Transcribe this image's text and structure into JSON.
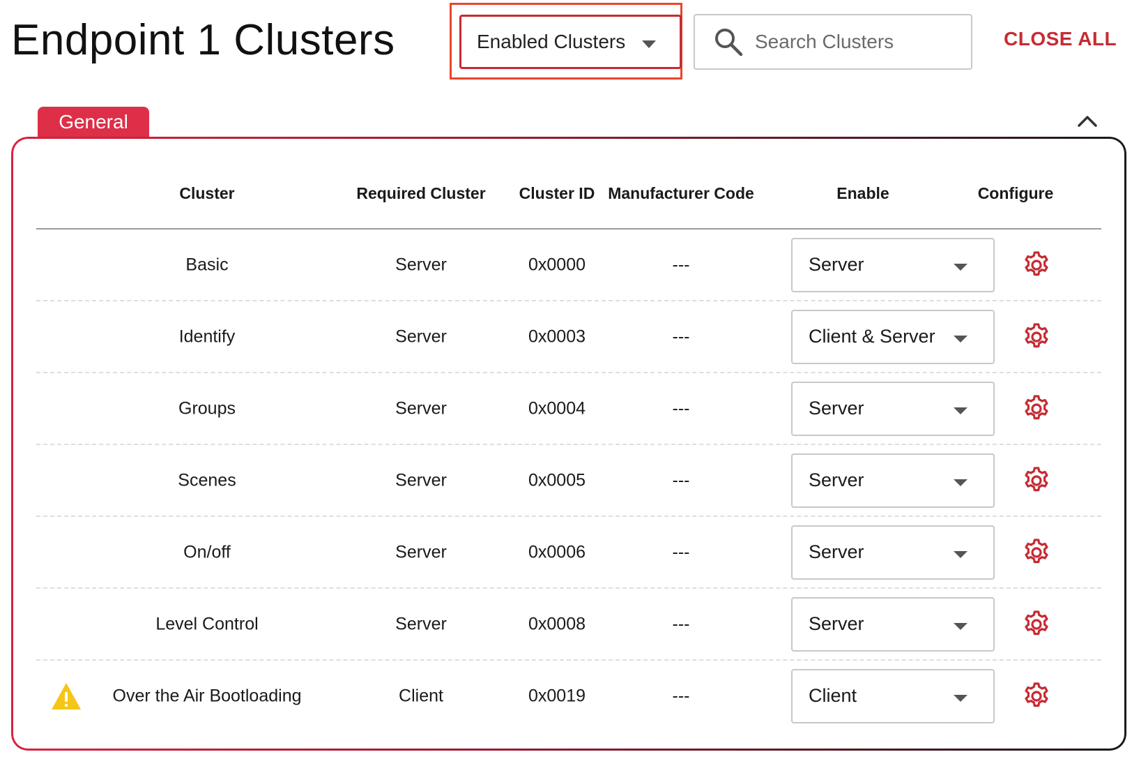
{
  "header": {
    "title": "Endpoint 1 Clusters",
    "filter_label": "Enabled Clusters",
    "search_placeholder": "Search Clusters",
    "close_all_label": "CLOSE ALL"
  },
  "section": {
    "tab_label": "General",
    "collapse_icon": "chevron-up-icon"
  },
  "table": {
    "columns": {
      "cluster": "Cluster",
      "required": "Required Cluster",
      "cluster_id": "Cluster ID",
      "manufacturer_code": "Manufacturer Code",
      "enable": "Enable",
      "configure": "Configure"
    },
    "rows": [
      {
        "cluster": "Basic",
        "required": "Server",
        "cluster_id": "0x0000",
        "manufacturer_code": "---",
        "enable": "Server",
        "warning": false
      },
      {
        "cluster": "Identify",
        "required": "Server",
        "cluster_id": "0x0003",
        "manufacturer_code": "---",
        "enable": "Client & Server",
        "warning": false
      },
      {
        "cluster": "Groups",
        "required": "Server",
        "cluster_id": "0x0004",
        "manufacturer_code": "---",
        "enable": "Server",
        "warning": false
      },
      {
        "cluster": "Scenes",
        "required": "Server",
        "cluster_id": "0x0005",
        "manufacturer_code": "---",
        "enable": "Server",
        "warning": false
      },
      {
        "cluster": "On/off",
        "required": "Server",
        "cluster_id": "0x0006",
        "manufacturer_code": "---",
        "enable": "Server",
        "warning": false
      },
      {
        "cluster": "Level Control",
        "required": "Server",
        "cluster_id": "0x0008",
        "manufacturer_code": "---",
        "enable": "Server",
        "warning": false
      },
      {
        "cluster": "Over the Air Bootloading",
        "required": "Client",
        "cluster_id": "0x0019",
        "manufacturer_code": "---",
        "enable": "Client",
        "warning": true
      }
    ]
  },
  "colors": {
    "accent": "#c62b33",
    "tab": "#dd2f48",
    "highlight": "#e8462c",
    "warning": "#f5c518"
  }
}
